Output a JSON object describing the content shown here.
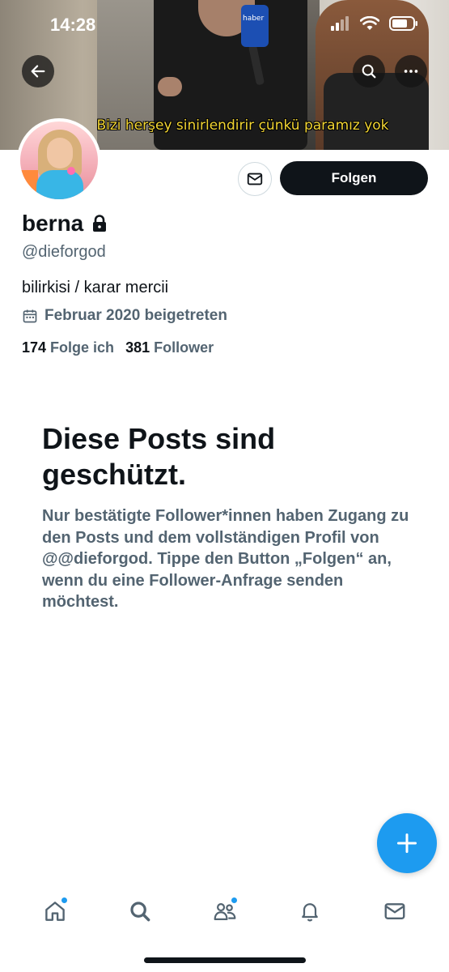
{
  "status_bar": {
    "time": "14:28"
  },
  "banner": {
    "subtitle": "Bizi herşey sinirlendirir çünkü paramız yok",
    "mic_label": "haber"
  },
  "header": {
    "back_icon": "arrow-left-icon",
    "search_icon": "search-icon",
    "more_icon": "more-icon"
  },
  "profile": {
    "display_name": "berna",
    "protected_icon": "lock-icon",
    "handle": "@dieforgod",
    "bio": "bilirkisi / karar mercii",
    "joined": "Februar 2020 beigetreten",
    "following_count": "174",
    "following_label": "Folge ich",
    "followers_count": "381",
    "followers_label": "Follower"
  },
  "actions": {
    "follow_label": "Folgen",
    "message_icon": "mail-icon"
  },
  "protected_notice": {
    "title": "Diese Posts sind geschützt.",
    "body": "Nur bestätigte Follower*innen haben Zugang zu den Posts und dem vollständigen Profil von @@dieforgod. Tippe den Button „Folgen“ an, wenn du eine Follower-Anfrage senden möchtest."
  },
  "bottom_nav": [
    {
      "icon": "home-icon",
      "has_dot": true
    },
    {
      "icon": "search-icon",
      "has_dot": false
    },
    {
      "icon": "communities-icon",
      "has_dot": true
    },
    {
      "icon": "bell-icon",
      "has_dot": false
    },
    {
      "icon": "mail-icon",
      "has_dot": false
    }
  ],
  "colors": {
    "accent": "#1d9bf0",
    "text_primary": "#0f1419",
    "text_secondary": "#536471"
  }
}
